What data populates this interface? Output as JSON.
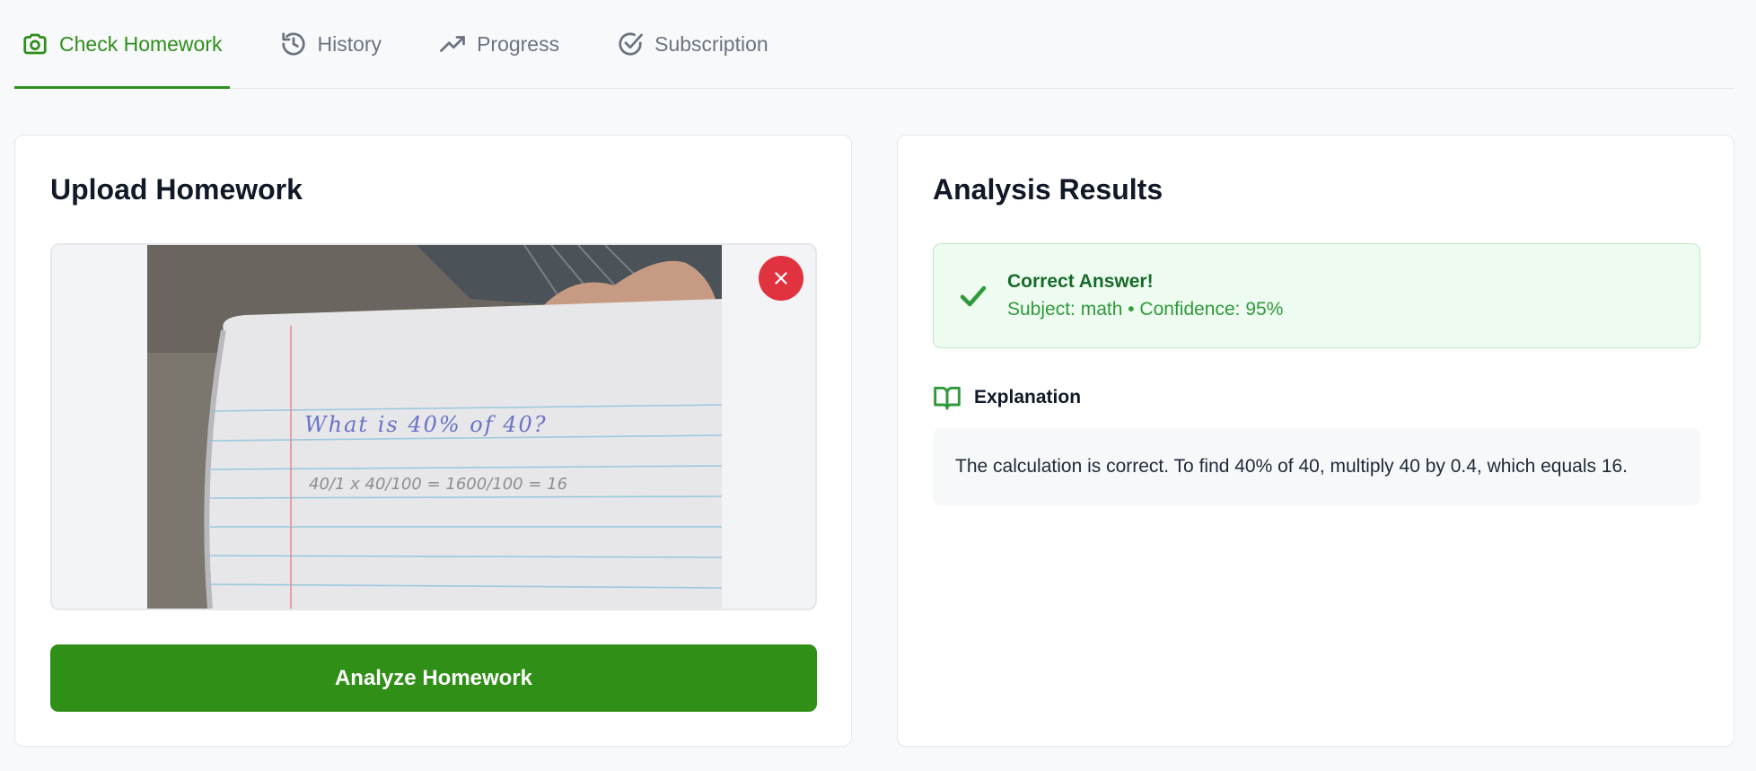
{
  "tabs": [
    {
      "label": "Check Homework",
      "icon": "camera-icon",
      "active": true
    },
    {
      "label": "History",
      "icon": "history-icon",
      "active": false
    },
    {
      "label": "Progress",
      "icon": "trending-up-icon",
      "active": false
    },
    {
      "label": "Subscription",
      "icon": "check-circle-icon",
      "active": false
    }
  ],
  "upload": {
    "title": "Upload Homework",
    "analyze_label": "Analyze Homework",
    "image_alt": "Photo of handwritten homework: What is 40% of 40?"
  },
  "results": {
    "title": "Analysis Results",
    "status_title": "Correct Answer!",
    "status_sub": "Subject: math • Confidence: 95%",
    "explanation_label": "Explanation",
    "explanation_text": "The calculation is correct. To find 40% of 40, multiply 40 by 0.4, which equals 16."
  },
  "colors": {
    "accent": "#2f8f1c",
    "danger": "#e0323f",
    "success_bg": "#eefbf0",
    "success_text": "#166b2a"
  }
}
